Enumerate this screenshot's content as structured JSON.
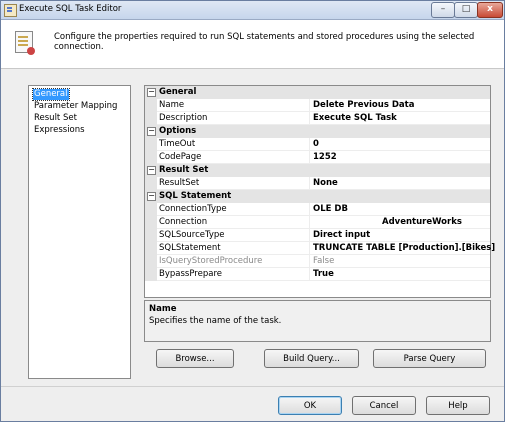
{
  "window": {
    "title": "Execute SQL Task Editor",
    "controls": {
      "minimize": "–",
      "maximize": "□",
      "close": "x"
    }
  },
  "header": {
    "icon": "task-editor-icon",
    "description": "Configure the properties required to run SQL statements and stored procedures using the selected connection."
  },
  "nav": {
    "items": [
      {
        "label": "General",
        "selected": true
      },
      {
        "label": "Parameter Mapping",
        "selected": false
      },
      {
        "label": "Result Set",
        "selected": false
      },
      {
        "label": "Expressions",
        "selected": false
      }
    ]
  },
  "grid": {
    "toggle_symbol": "−",
    "general": {
      "label": "General",
      "name": {
        "label": "Name",
        "value": "Delete Previous Data"
      },
      "description": {
        "label": "Description",
        "value": "Execute SQL Task"
      }
    },
    "options": {
      "label": "Options",
      "timeout": {
        "label": "TimeOut",
        "value": "0"
      },
      "codepage": {
        "label": "CodePage",
        "value": "1252"
      }
    },
    "result_set": {
      "label": "Result Set",
      "resultset": {
        "label": "ResultSet",
        "value": "None"
      }
    },
    "sql_statement": {
      "label": "SQL Statement",
      "connection_type": {
        "label": "ConnectionType",
        "value": "OLE DB"
      },
      "connection": {
        "label": "Connection",
        "value": "AdventureWorks"
      },
      "sql_source_type": {
        "label": "SQLSourceType",
        "value": "Direct input"
      },
      "sql_statement": {
        "label": "SQLStatement",
        "value": "TRUNCATE TABLE [Production].[Bikes]"
      },
      "is_query_stored_procedure": {
        "label": "IsQueryStoredProcedure",
        "value": "False"
      },
      "bypass_prepare": {
        "label": "BypassPrepare",
        "value": "True"
      }
    }
  },
  "description_panel": {
    "title": "Name",
    "text": "Specifies the name of the task."
  },
  "buttons": {
    "browse": "Browse...",
    "build_query": "Build Query...",
    "parse_query": "Parse Query",
    "ok": "OK",
    "cancel": "Cancel",
    "help": "Help"
  }
}
